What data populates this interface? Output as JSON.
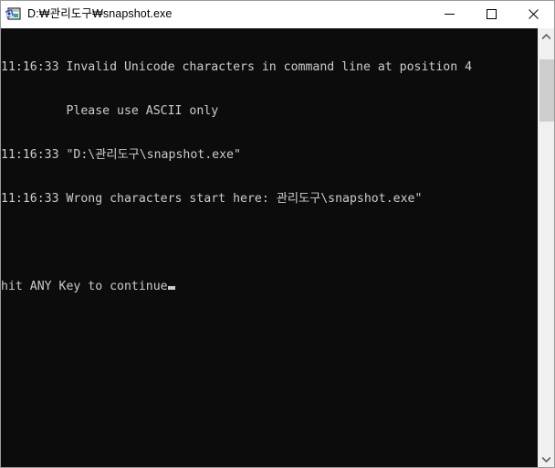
{
  "window": {
    "title": "D:₩관리도구₩snapshot.exe",
    "icon_name": "snapshot-app-icon",
    "background_color": "#0c0c0c",
    "titlebar_color": "#ffffff",
    "border_color": "#9a9a9a"
  },
  "window_controls": {
    "minimize_label": "Minimize",
    "maximize_label": "Maximize",
    "close_label": "Close"
  },
  "console": {
    "text_color": "#cccccc",
    "font_size": "13.2px",
    "lines": [
      "11:16:33 Invalid Unicode characters in command line at position 4",
      "         Please use ASCII only",
      "11:16:33 \"D:\\관리도구\\snapshot.exe\"",
      "11:16:33 Wrong characters start here: 관리도구\\snapshot.exe\"",
      "",
      "hit ANY Key to continue"
    ],
    "prompt_line_index": 5,
    "cursor_visible": true
  },
  "scrollbar": {
    "up_arrow_label": "Scroll up",
    "down_arrow_label": "Scroll down",
    "thumb_position_percent": 4,
    "track_color": "#f0f0f0",
    "thumb_color": "#cdcdcd"
  }
}
